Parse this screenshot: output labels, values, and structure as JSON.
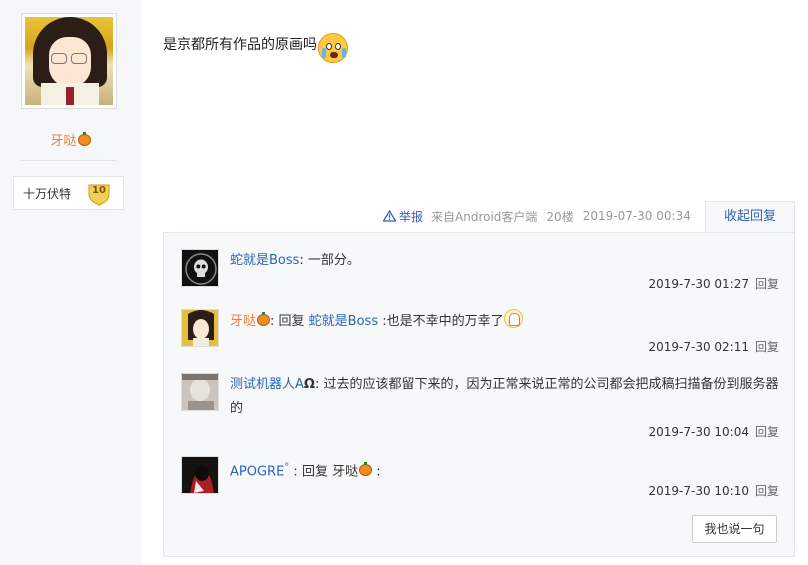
{
  "user": {
    "name": "牙哒",
    "badge_name": "十万伏特",
    "badge_level": "10"
  },
  "post": {
    "text": "是京都所有作品的原画吗",
    "emoji": "cry-emoji-icon"
  },
  "tail": {
    "report": "举报",
    "source": "来自Android客户端",
    "floor": "20楼",
    "time": "2019-07-30 00:34",
    "collapse": "收起回复"
  },
  "replies": [
    {
      "name": "蛇就是Boss",
      "text": ": 一部分。",
      "time": "2019-7-30 01:27",
      "reply_label": "回复"
    },
    {
      "name": "牙哒",
      "prefix": ": 回复 ",
      "target": "蛇就是Boss",
      "text": " :也是不幸中的万幸了",
      "time": "2019-7-30 02:11",
      "reply_label": "回复"
    },
    {
      "name": "测试机器人A",
      "name_suffix": "Ω",
      "text": ": 过去的应该都留下来的，因为正常来说正常的公司都会把成稿扫描备份到服务器的",
      "time": "2019-7-30 10:04",
      "reply_label": "回复"
    },
    {
      "name": "APOGRE",
      "name_suffix": "°",
      "prefix": " : 回复 ",
      "target": "牙哒",
      "text": " :",
      "time": "2019-7-30 10:10",
      "reply_label": "回复"
    }
  ],
  "write_button": "我也说一句",
  "colors": {
    "link": "#2d64b3",
    "username": "#f67e37",
    "panel_bg": "#f7f8fa"
  }
}
